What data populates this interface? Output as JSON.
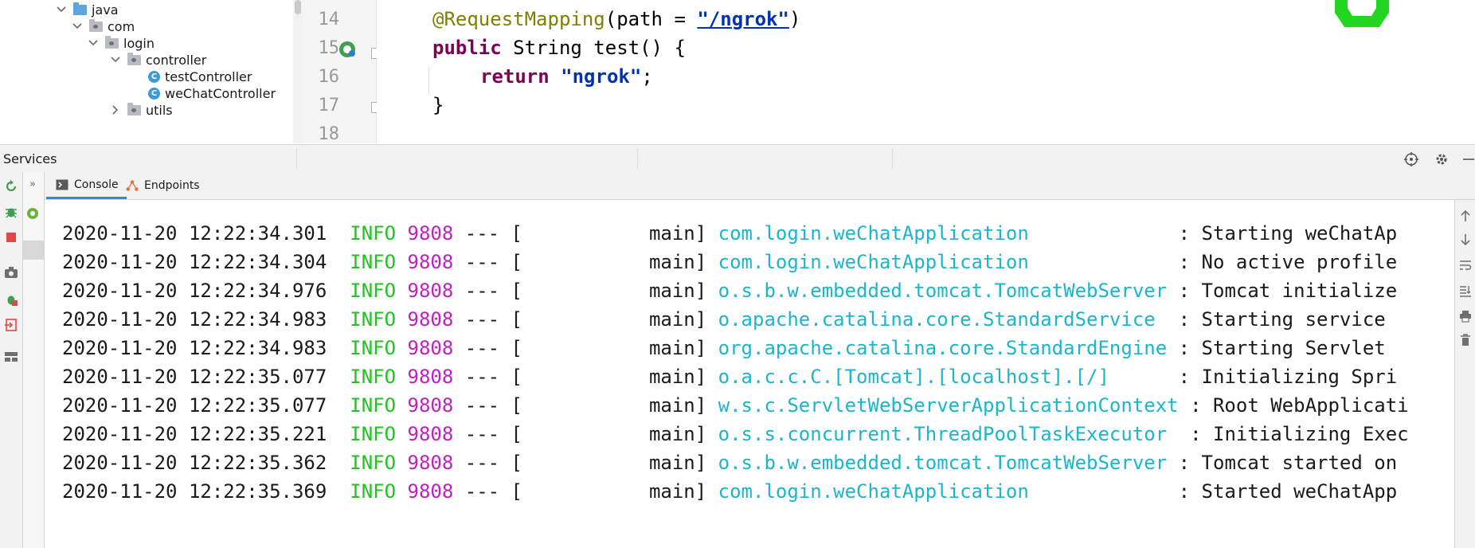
{
  "project_tree": {
    "items": [
      {
        "label": "java",
        "icon": "folder-icon",
        "kind": "source-folder",
        "expanded": true
      },
      {
        "label": "com",
        "icon": "package-icon",
        "kind": "package",
        "expanded": true
      },
      {
        "label": "login",
        "icon": "package-icon",
        "kind": "package",
        "expanded": true
      },
      {
        "label": "controller",
        "icon": "package-icon",
        "kind": "package",
        "expanded": true
      },
      {
        "label": "testController",
        "icon": "class-icon",
        "kind": "class"
      },
      {
        "label": "weChatController",
        "icon": "class-icon",
        "kind": "class"
      },
      {
        "label": "utils",
        "icon": "package-icon",
        "kind": "package",
        "expanded": false
      }
    ],
    "class_badge": "C"
  },
  "editor": {
    "line_numbers": [
      "14",
      "15",
      "16",
      "17",
      "18"
    ],
    "lines": [
      {
        "annotation": "@RequestMapping",
        "open": "(path = ",
        "path_string": "\"/ngrok\"",
        "close": ")"
      },
      {
        "kw": "public",
        "rest": " String test() {"
      },
      {
        "kw": "return",
        "string": "\"ngrok\"",
        "end": ";"
      },
      {
        "text": "}"
      }
    ]
  },
  "services": {
    "title": "Services",
    "tabs": [
      {
        "label": "Console",
        "icon": "console-icon",
        "active": true
      },
      {
        "label": "Endpoints",
        "icon": "endpoints-icon",
        "active": false
      }
    ],
    "expand_glyph": "»"
  },
  "console": {
    "lines": [
      {
        "ts": "2020-11-20 12:22:34.301",
        "level": "INFO",
        "pid": "9808",
        "sep": " --- [",
        "thread": "main]",
        "logger": "com.login.weChatApplication",
        "msg": ": Starting weChatAp"
      },
      {
        "ts": "2020-11-20 12:22:34.304",
        "level": "INFO",
        "pid": "9808",
        "sep": " --- [",
        "thread": "main]",
        "logger": "com.login.weChatApplication",
        "msg": ": No active profile"
      },
      {
        "ts": "2020-11-20 12:22:34.976",
        "level": "INFO",
        "pid": "9808",
        "sep": " --- [",
        "thread": "main]",
        "logger": "o.s.b.w.embedded.tomcat.TomcatWebServer",
        "msg": ": Tomcat initialize"
      },
      {
        "ts": "2020-11-20 12:22:34.983",
        "level": "INFO",
        "pid": "9808",
        "sep": " --- [",
        "thread": "main]",
        "logger": "o.apache.catalina.core.StandardService",
        "msg": ": Starting service"
      },
      {
        "ts": "2020-11-20 12:22:34.983",
        "level": "INFO",
        "pid": "9808",
        "sep": " --- [",
        "thread": "main]",
        "logger": "org.apache.catalina.core.StandardEngine",
        "msg": ": Starting Servlet"
      },
      {
        "ts": "2020-11-20 12:22:35.077",
        "level": "INFO",
        "pid": "9808",
        "sep": " --- [",
        "thread": "main]",
        "logger": "o.a.c.c.C.[Tomcat].[localhost].[/]",
        "msg": ": Initializing Spri"
      },
      {
        "ts": "2020-11-20 12:22:35.077",
        "level": "INFO",
        "pid": "9808",
        "sep": " --- [",
        "thread": "main]",
        "logger": "w.s.c.ServletWebServerApplicationContext",
        "msg": ": Root WebApplicati"
      },
      {
        "ts": "2020-11-20 12:22:35.221",
        "level": "INFO",
        "pid": "9808",
        "sep": " --- [",
        "thread": "main]",
        "logger": "o.s.s.concurrent.ThreadPoolTaskExecutor",
        "msg": ": Initializing Exec"
      },
      {
        "ts": "2020-11-20 12:22:35.362",
        "level": "INFO",
        "pid": "9808",
        "sep": " --- [",
        "thread": "main]",
        "logger": "o.s.b.w.embedded.tomcat.TomcatWebServer",
        "msg": ": Tomcat started on"
      },
      {
        "ts": "2020-11-20 12:22:35.369",
        "level": "INFO",
        "pid": "9808",
        "sep": " --- [",
        "thread": "main]",
        "logger": "com.login.weChatApplication",
        "msg": ": Started weChatApp"
      }
    ]
  },
  "colors": {
    "info": "#1ec41e",
    "pid": "#c020c0",
    "logger": "#1cb5c9",
    "annotation": "#808000",
    "keyword": "#7f0055",
    "string": "#0033b3",
    "tab_underline": "#4083c9"
  },
  "icons": {
    "left_toolbar": [
      "rerun-icon",
      "debug-icon",
      "stop-icon",
      "camera-icon",
      "deploy-icon",
      "exit-icon",
      "layout-icon"
    ],
    "right_toolbar": [
      "scroll-up-icon",
      "scroll-down-icon",
      "soft-wrap-icon",
      "scroll-to-end-icon",
      "print-icon",
      "trash-icon"
    ],
    "header": [
      "target-icon",
      "gear-icon",
      "minimize-icon"
    ]
  }
}
